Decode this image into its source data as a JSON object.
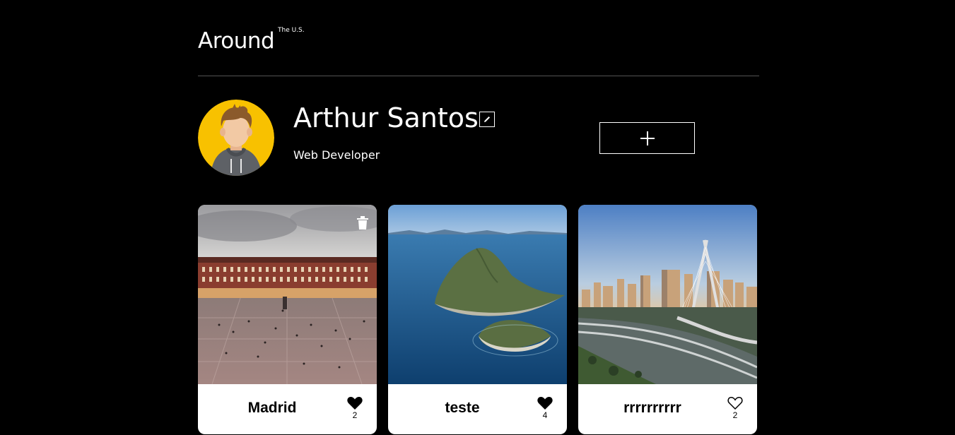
{
  "header": {
    "logo": "Around",
    "logo_sup": "The U.S."
  },
  "profile": {
    "name": "Arthur Santos",
    "role": "Web Developer",
    "avatar_icon": "avatar-illustration"
  },
  "toolbar": {
    "edit_icon": "pencil-icon",
    "add_icon": "plus-icon"
  },
  "cards": [
    {
      "title": "Madrid",
      "likes": "2",
      "liked": true,
      "has_delete": true
    },
    {
      "title": "teste",
      "likes": "4",
      "liked": true,
      "has_delete": false
    },
    {
      "title": "rrrrrrrrrr",
      "likes": "2",
      "liked": false,
      "has_delete": false
    }
  ],
  "colors": {
    "background": "#000000",
    "avatar_bg": "#F8C100",
    "card_bg": "#FFFFFF"
  }
}
